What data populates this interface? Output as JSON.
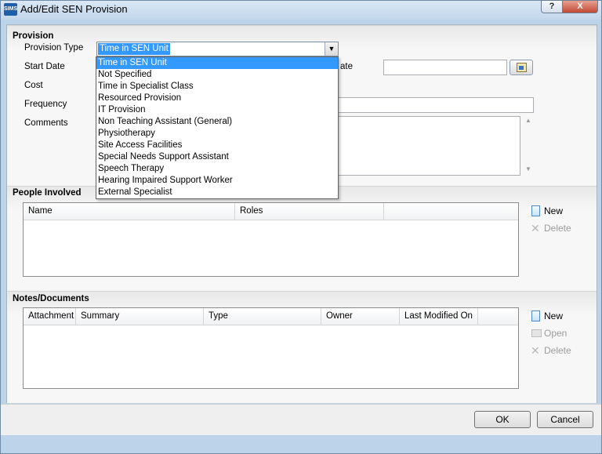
{
  "window": {
    "app_icon": "SIMS",
    "title": "Add/Edit SEN Provision",
    "help_label": "?",
    "close_label": "X"
  },
  "provision": {
    "section_title": "Provision",
    "type_label": "Provision Type",
    "type_value": "Time in SEN Unit",
    "start_label": "Start Date",
    "end_label_fragment": "ate",
    "cost_label": "Cost",
    "frequency_label": "Frequency",
    "comments_label": "Comments",
    "options": [
      "Time in SEN Unit",
      "Not Specified",
      "Time in Specialist Class",
      "Resourced Provision",
      "IT Provision",
      "Non Teaching Assistant (General)",
      "Physiotherapy",
      "Site Access Facilities",
      "Special Needs Support Assistant",
      "Speech Therapy",
      "Hearing Impaired Support Worker",
      "External Specialist"
    ]
  },
  "people": {
    "section_title": "People Involved",
    "columns": [
      "Name",
      "Roles",
      ""
    ],
    "new_label": "New",
    "delete_label": "Delete"
  },
  "notes": {
    "section_title": "Notes/Documents",
    "columns": [
      "Attachment",
      "Summary",
      "Type",
      "Owner",
      "Last Modified On",
      ""
    ],
    "new_label": "New",
    "open_label": "Open",
    "delete_label": "Delete"
  },
  "footer": {
    "ok_label": "OK",
    "cancel_label": "Cancel"
  },
  "colors": {
    "selection": "#3399ff",
    "frame": "#bcd3ea",
    "panel": "#f3f3f3"
  }
}
